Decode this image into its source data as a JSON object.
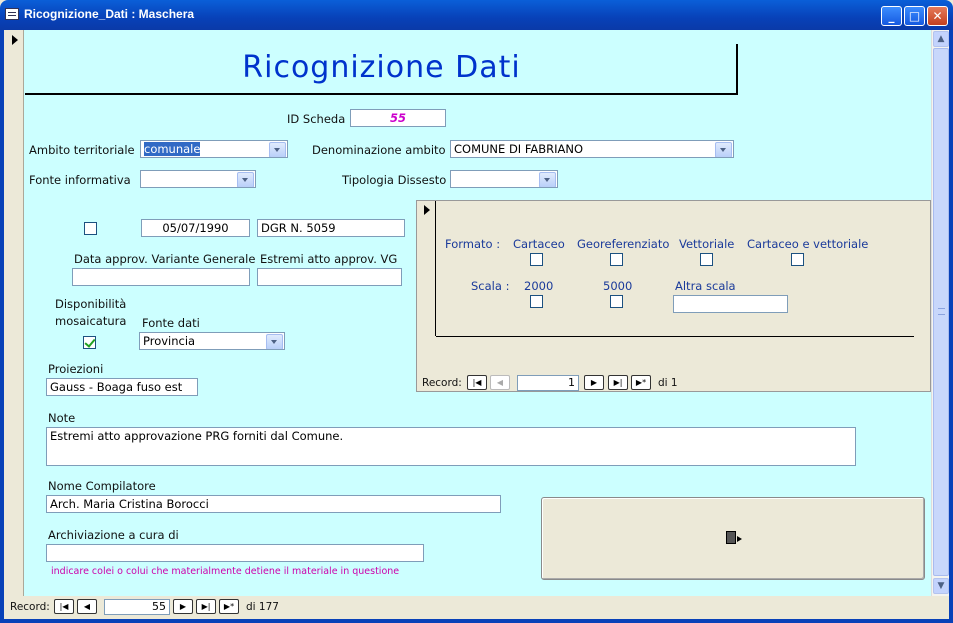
{
  "window": {
    "title": "Ricognizione_Dati : Maschera",
    "minimize": "_",
    "maximize": "□",
    "close": "✕"
  },
  "header": {
    "title": "Ricognizione  Dati"
  },
  "form": {
    "id_scheda_label": "ID Scheda",
    "id_scheda_value": "55",
    "ambito_label": "Ambito territoriale",
    "ambito_value": "comunale",
    "denominazione_label": "Denominazione ambito",
    "denominazione_value": "COMUNE DI FABRIANO",
    "fonte_informativa_label": "Fonte informativa",
    "fonte_informativa_value": "",
    "tipologia_label": "Tipologia Dissesto",
    "tipologia_value": "",
    "prg_checked": false,
    "prg_date": "05/07/1990",
    "prg_atto": "DGR N. 5059",
    "data_variante_label": "Data approv. Variante Generale",
    "data_variante_value": "",
    "estremi_vg_label": "Estremi atto approv. VG",
    "estremi_vg_value": "",
    "mosaicatura_label_1": "Disponibilità",
    "mosaicatura_label_2": "mosaicatura",
    "mosaicatura_checked": true,
    "fonte_dati_label": "Fonte dati",
    "fonte_dati_value": "Provincia",
    "proiezioni_label": "Proiezioni",
    "proiezioni_value": "Gauss - Boaga fuso est",
    "note_label": "Note",
    "note_value": "Estremi atto approvazione PRG forniti dal Comune.",
    "compilatore_label": "Nome Compilatore",
    "compilatore_value": "Arch. Maria Cristina Borocci",
    "archiviazione_label": "Archiviazione a cura di",
    "archiviazione_value": "",
    "archiviazione_hint": "indicare colei o colui che materialmente detiene il materiale in questione"
  },
  "subform": {
    "formato_label": "Formato :",
    "formati": [
      "Cartaceo",
      "Georeferenziato",
      "Vettoriale",
      "Cartaceo e vettoriale"
    ],
    "scala_label": "Scala :",
    "scale": [
      "2000",
      "5000"
    ],
    "altra_scala_label": "Altra scala",
    "altra_scala_value": "",
    "record_label": "Record:",
    "record_current": "1",
    "record_total": "di 1"
  },
  "nav": {
    "record_label": "Record:",
    "record_current": "55",
    "record_total": "di 177",
    "first": "|◀",
    "prev": "◀",
    "next": "▶",
    "last": "▶|",
    "new": "▶*"
  },
  "exit_button": {
    "icon": "exit-door-icon"
  }
}
